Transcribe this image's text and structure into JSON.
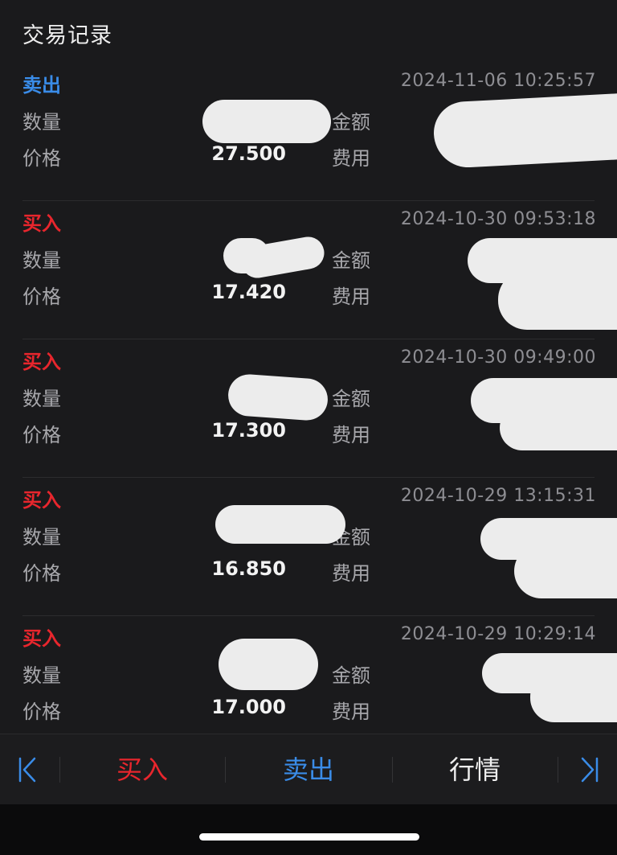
{
  "header": {
    "title": "交易记录"
  },
  "labels": {
    "quantity": "数量",
    "price": "价格",
    "amount": "金额",
    "fee": "费用"
  },
  "records": [
    {
      "type": "卖出",
      "type_color": "#3a8ce8",
      "time": "2024-11-06 10:25:57",
      "price": "27.500"
    },
    {
      "type": "买入",
      "type_color": "#e8262d",
      "time": "2024-10-30 09:53:18",
      "price": "17.420"
    },
    {
      "type": "买入",
      "type_color": "#e8262d",
      "time": "2024-10-30 09:49:00",
      "price": "17.300"
    },
    {
      "type": "买入",
      "type_color": "#e8262d",
      "time": "2024-10-29 13:15:31",
      "price": "16.850"
    },
    {
      "type": "买入",
      "type_color": "#e8262d",
      "time": "2024-10-29 10:29:14",
      "price": "17.000"
    }
  ],
  "toolbar": {
    "first_icon": "first-page-icon",
    "buy_label": "买入",
    "sell_label": "卖出",
    "quote_label": "行情",
    "last_icon": "last-page-icon",
    "buy_color": "#e8262d",
    "sell_color": "#3a8ce8",
    "quote_color": "#eeeeee",
    "icon_color": "#3a8ce8"
  }
}
